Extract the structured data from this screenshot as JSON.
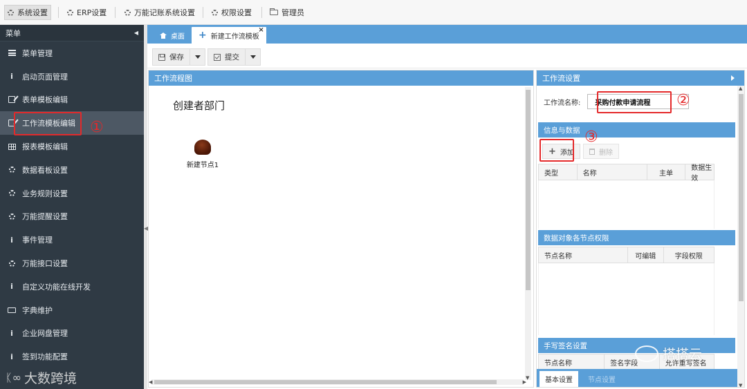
{
  "topmenu": {
    "items": [
      {
        "label": "系统设置",
        "icon": "gear-icon"
      },
      {
        "label": "ERP设置",
        "icon": "gear-icon"
      },
      {
        "label": "万能记账系统设置",
        "icon": "gear-icon"
      },
      {
        "label": "权限设置",
        "icon": "gear-icon"
      },
      {
        "label": "管理员",
        "icon": "folder-icon"
      }
    ]
  },
  "sidebar": {
    "title": "菜单",
    "items": [
      {
        "label": "菜单管理",
        "icon": "list-icon"
      },
      {
        "label": "启动页面管理",
        "icon": "info-icon"
      },
      {
        "label": "表单模板编辑",
        "icon": "edit-icon"
      },
      {
        "label": "工作流模板编辑",
        "icon": "edit-icon",
        "active": true
      },
      {
        "label": "报表模板编辑",
        "icon": "table-icon"
      },
      {
        "label": "数据看板设置",
        "icon": "gear-icon"
      },
      {
        "label": "业务规则设置",
        "icon": "gear-icon"
      },
      {
        "label": "万能提醒设置",
        "icon": "gear-icon"
      },
      {
        "label": "事件管理",
        "icon": "info-icon"
      },
      {
        "label": "万能接口设置",
        "icon": "gear-icon"
      },
      {
        "label": "自定义功能在线开发",
        "icon": "info-icon"
      },
      {
        "label": "字典维护",
        "icon": "keyboard-icon"
      },
      {
        "label": "企业网盘管理",
        "icon": "info-icon"
      },
      {
        "label": "签到功能配置",
        "icon": "info-icon"
      }
    ],
    "watermark": "大数跨境"
  },
  "tabs": {
    "home": "桌面",
    "active": "新建工作流模板"
  },
  "toolbar": {
    "save": "保存",
    "submit": "提交"
  },
  "canvas": {
    "title": "工作流程图",
    "department": "创建者部门",
    "node_label": "新建节点1"
  },
  "settings": {
    "title": "工作流设置",
    "name_label": "工作流名称:",
    "name_value": "采购付款申请流程",
    "info_title": "信息与数据",
    "add": "添加",
    "delete": "删除",
    "info_columns": [
      "类型",
      "名称",
      "主单",
      "数据生效"
    ],
    "perm_title": "数据对象各节点权限",
    "perm_columns": [
      "节点名称",
      "可编辑",
      "字段权限"
    ],
    "sign_title": "手写签名设置",
    "sign_columns": [
      "节点名称",
      "签名字段",
      "允许重写签名"
    ],
    "bottom_tabs": [
      "基本设置",
      "节点设置"
    ],
    "watermark": "搭搭云"
  },
  "annotations": [
    "①",
    "②",
    "③"
  ],
  "colors": {
    "sidebar_bg": "#2f3a44",
    "header_blue": "#5a9fd8",
    "highlight_red": "#e4292a"
  }
}
